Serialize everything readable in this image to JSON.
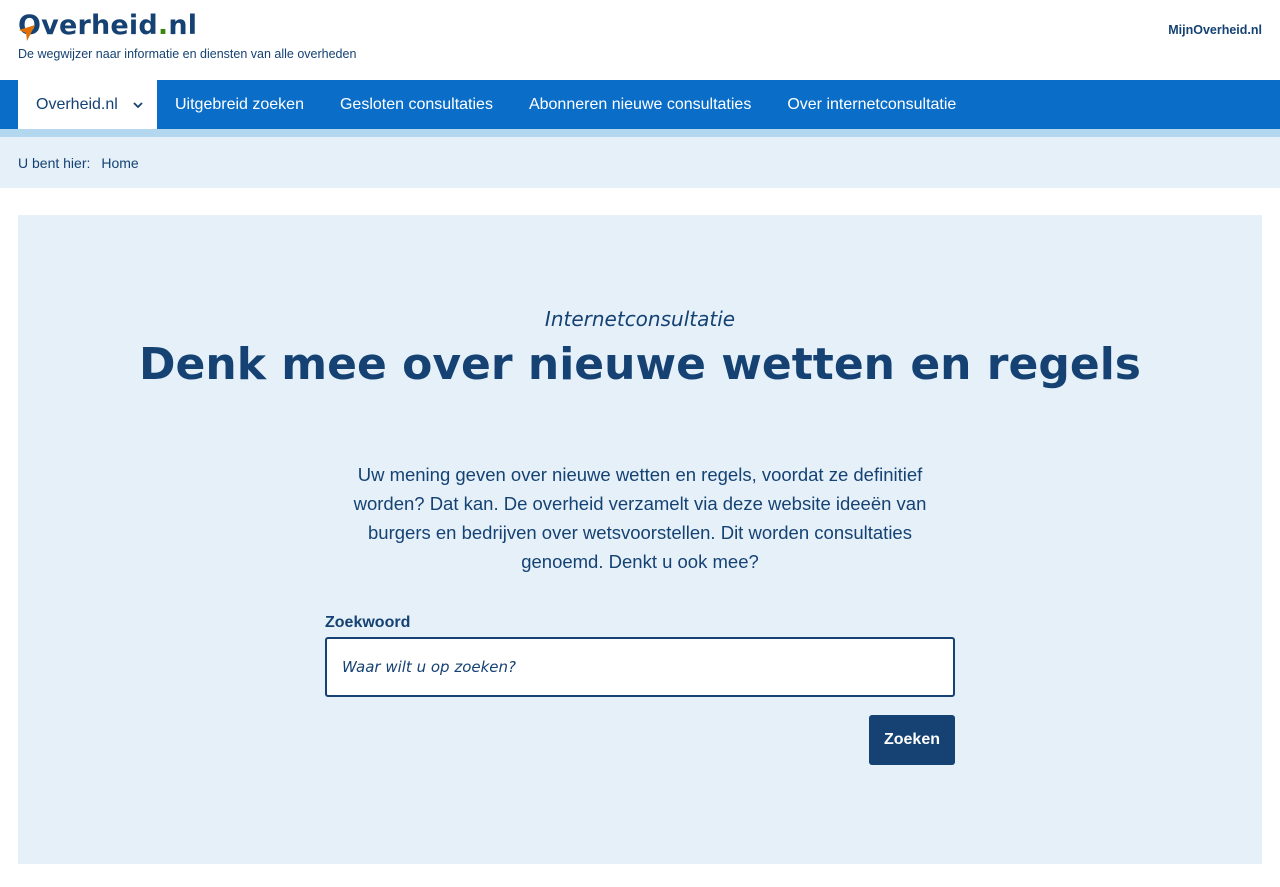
{
  "header": {
    "logo_text": "Overheid",
    "logo_dot": ".",
    "logo_suffix": "nl",
    "tagline": "De wegwijzer naar informatie en diensten van alle overheden",
    "mijn_link": "MijnOverheid.nl"
  },
  "nav": {
    "items": [
      {
        "label": "Overheid.nl"
      },
      {
        "label": "Uitgebreid zoeken"
      },
      {
        "label": "Gesloten consultaties"
      },
      {
        "label": "Abonneren nieuwe consultaties"
      },
      {
        "label": "Over internetconsultatie"
      }
    ]
  },
  "breadcrumb": {
    "label": "U bent hier:",
    "home": "Home"
  },
  "hero": {
    "kicker": "Internetconsultatie",
    "title": "Denk mee over nieuwe wetten en regels",
    "intro": "Uw mening geven over nieuwe wetten en regels, voordat ze definitief worden? Dat kan. De overheid verzamelt via deze website ideeën van burgers en bedrijven over wetsvoorstellen. Dit worden consultaties genoemd. Denkt u ook mee?",
    "search_label": "Zoekwoord",
    "search_placeholder": "Waar wilt u op zoeken?",
    "search_button": "Zoeken"
  },
  "colors": {
    "brand_dark": "#154273",
    "nav_blue": "#0a6ec8",
    "light_bg": "#e5f0f9",
    "accent_orange": "#e17000"
  }
}
